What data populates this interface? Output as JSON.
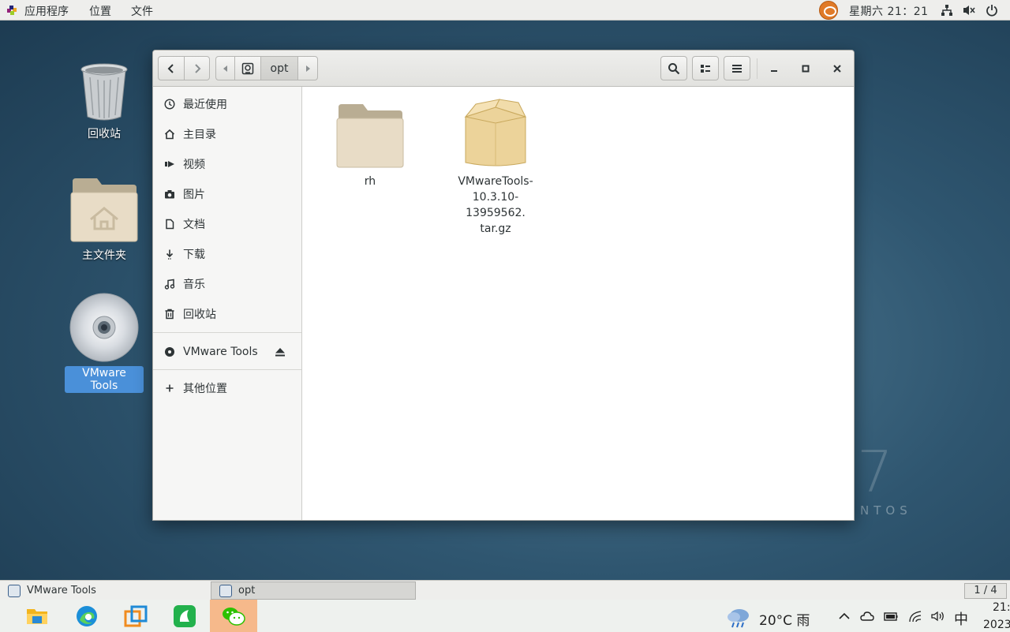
{
  "topbar": {
    "applications": "应用程序",
    "places": "位置",
    "file": "文件",
    "clock": "星期六 21：21"
  },
  "desktop": {
    "icons": [
      {
        "label": "回收站"
      },
      {
        "label": "主文件夹"
      },
      {
        "label": "VMware Tools"
      }
    ],
    "watermark_text": "NTOS",
    "watermark_digit": "7"
  },
  "window": {
    "path": {
      "current": "opt"
    },
    "sidebar": {
      "items": [
        {
          "label": "最近使用",
          "icon": "clock-icon"
        },
        {
          "label": "主目录",
          "icon": "home-icon"
        },
        {
          "label": "视频",
          "icon": "video-icon"
        },
        {
          "label": "图片",
          "icon": "camera-icon"
        },
        {
          "label": "文档",
          "icon": "document-icon"
        },
        {
          "label": "下载",
          "icon": "download-icon"
        },
        {
          "label": "音乐",
          "icon": "music-icon"
        },
        {
          "label": "回收站",
          "icon": "trash-icon"
        }
      ],
      "devices": [
        {
          "label": "VMware Tools",
          "icon": "disc-icon"
        }
      ],
      "other": {
        "label": "其他位置",
        "icon": "plus-icon"
      }
    },
    "files": [
      {
        "name": "rh",
        "type": "folder"
      },
      {
        "name_lines": [
          "VMwareTools-",
          "10.3.10-13959562.",
          "tar.gz"
        ],
        "type": "archive"
      }
    ]
  },
  "taskbar": {
    "tasks": [
      {
        "label": "VMware Tools"
      },
      {
        "label": "opt"
      }
    ],
    "pager": "1 / 4"
  },
  "host_taskbar": {
    "weather": "20°C 雨",
    "ime": "中",
    "time": "21:",
    "date": "2023"
  }
}
